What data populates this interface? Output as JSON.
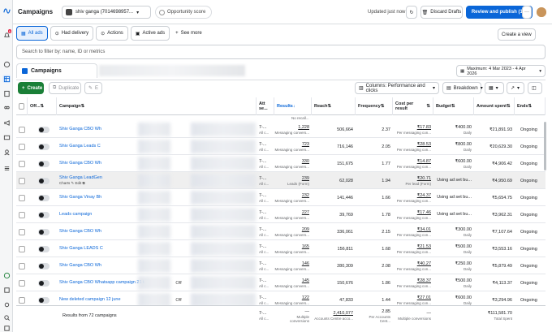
{
  "header": {
    "title": "Campaigns",
    "account": "shiv ganga (7014698957...",
    "opportunity": "Opportunity score",
    "updated": "Updated just now",
    "discard": "Discard Drafts",
    "publish": "Review and publish (10)",
    "more": "···"
  },
  "nav": {
    "badge": "6"
  },
  "tabs": {
    "all_ads": "All ads",
    "had_delivery": "Had delivery",
    "actions": "Actions",
    "active_ads": "Active ads",
    "see_more": "See more",
    "create_view": "Create a view"
  },
  "filter": {
    "placeholder": "Search to filter by: name, ID or metrics"
  },
  "level_tab": "Campaigns",
  "date_range": "Maximum: 4 Mar 2023 - 4 Apr 2026",
  "toolbar": {
    "create": "Create",
    "duplicate": "Duplicate",
    "edit": "E",
    "columns": "Columns: Performance and clicks",
    "breakdown": "Breakdown"
  },
  "columns": [
    "Off...",
    "Campaign",
    "Att se...",
    "Results",
    "Reach",
    "Frequency",
    "Cost per result",
    "Budget",
    "Amount spent",
    "Ends"
  ],
  "top_partial_row": {
    "results_sub": "No recall..."
  },
  "rows": [
    {
      "toggle": "",
      "name": "Shiv Ganga CBO Wh",
      "attr": "7-...",
      "attr_sub": "All c...",
      "results": "1,228",
      "results_sub": "Messaging convers...",
      "reach": "506,664",
      "freq": "2.37",
      "cpr": "₹17.83",
      "cpr_sub": "Per messaging con...",
      "budget": "₹400.00",
      "budget_sub": "Daily",
      "spent": "₹21,891.93",
      "ends": "Ongoing",
      "highlight": false,
      "actions": ""
    },
    {
      "toggle": "",
      "name": "Shiv Ganga Leads C",
      "attr": "7-...",
      "attr_sub": "All c...",
      "results": "723",
      "results_sub": "Messaging convers...",
      "reach": "716,146",
      "freq": "2.05",
      "cpr": "₹28.53",
      "cpr_sub": "Per messaging con...",
      "budget": "₹800.00",
      "budget_sub": "Daily",
      "spent": "₹20,629.30",
      "ends": "Ongoing",
      "highlight": false,
      "actions": ""
    },
    {
      "toggle": "",
      "name": "Shiv Ganga CBO Wh",
      "attr": "7-...",
      "attr_sub": "All c...",
      "results": "330",
      "results_sub": "Messaging convers...",
      "reach": "151,675",
      "freq": "1.77",
      "cpr": "₹14.87",
      "cpr_sub": "Per messaging con...",
      "budget": "₹600.00",
      "budget_sub": "Daily",
      "spent": "₹4,906.42",
      "ends": "Ongoing",
      "highlight": false,
      "actions": ""
    },
    {
      "toggle": "",
      "name": "Shiv Ganga LeadGen",
      "attr": "7-...",
      "attr_sub": "All c...",
      "results": "239",
      "results_sub": "Leads (Form)",
      "reach": "62,028",
      "freq": "1.94",
      "cpr": "₹20.71",
      "cpr_sub": "Per lead (Form)",
      "budget": "Using ad set bu...",
      "budget_sub": "",
      "spent": "₹4,950.69",
      "ends": "Ongoing",
      "highlight": true,
      "actions": "Charts  ✎ Edit  ⧉"
    },
    {
      "toggle": "",
      "name": "Shiv Ganga Vinay Bh",
      "attr": "7-...",
      "attr_sub": "All c...",
      "results": "232",
      "results_sub": "Messaging convers...",
      "reach": "141,446",
      "freq": "1.66",
      "cpr": "₹24.37",
      "cpr_sub": "Per messaging con...",
      "budget": "Using ad set bu...",
      "budget_sub": "",
      "spent": "₹5,654.75",
      "ends": "Ongoing",
      "highlight": false,
      "actions": ""
    },
    {
      "toggle": "",
      "name": "Leads campaign",
      "attr": "7-...",
      "attr_sub": "All c...",
      "results": "227",
      "results_sub": "Messaging convers...",
      "reach": "39,769",
      "freq": "1.78",
      "cpr": "₹17.46",
      "cpr_sub": "Per messaging con...",
      "budget": "Using ad set bu...",
      "budget_sub": "",
      "spent": "₹3,962.31",
      "ends": "Ongoing",
      "highlight": false,
      "actions": ""
    },
    {
      "toggle": "",
      "name": "Shiv Ganga CBO Wh",
      "attr": "7-...",
      "attr_sub": "All c...",
      "results": "209",
      "results_sub": "Messaging convers...",
      "reach": "336,061",
      "freq": "2.15",
      "cpr": "₹34.01",
      "cpr_sub": "Per messaging con...",
      "budget": "₹300.00",
      "budget_sub": "Daily",
      "spent": "₹7,107.64",
      "ends": "Ongoing",
      "highlight": false,
      "actions": ""
    },
    {
      "toggle": "",
      "name": "Shiv Ganga LEADS C",
      "attr": "7-...",
      "attr_sub": "All c...",
      "results": "165",
      "results_sub": "Messaging convers...",
      "reach": "156,811",
      "freq": "1.68",
      "cpr": "₹21.53",
      "cpr_sub": "Per messaging con...",
      "budget": "₹500.00",
      "budget_sub": "Daily",
      "spent": "₹3,553.16",
      "ends": "Ongoing",
      "highlight": false,
      "actions": ""
    },
    {
      "toggle": "",
      "name": "Shiv Ganga CBO Wh",
      "attr": "7-...",
      "attr_sub": "All c...",
      "results": "146",
      "results_sub": "Messaging convers...",
      "reach": "280,309",
      "freq": "2.08",
      "cpr": "₹40.27",
      "cpr_sub": "Per messaging con...",
      "budget": "₹250.00",
      "budget_sub": "Daily",
      "spent": "₹5,879.49",
      "ends": "Ongoing",
      "highlight": false,
      "actions": ""
    },
    {
      "toggle": "Off",
      "name": "Shiv Ganga CBO Whatsapp campaign 21 tab...",
      "attr": "7-...",
      "attr_sub": "All c...",
      "results": "145",
      "results_sub": "Messaging convers...",
      "reach": "150,676",
      "freq": "1.86",
      "cpr": "₹28.37",
      "cpr_sub": "Per messaging con...",
      "budget": "₹500.00",
      "budget_sub": "Daily",
      "spent": "₹4,113.37",
      "ends": "Ongoing",
      "highlight": false,
      "actions": ""
    },
    {
      "toggle": "Off",
      "name": "New deleted campaign 12 june",
      "attr": "7-...",
      "attr_sub": "All c...",
      "results": "122",
      "results_sub": "Messaging convers...",
      "reach": "47,833",
      "freq": "1.44",
      "cpr": "₹27.01",
      "cpr_sub": "Per messaging con...",
      "budget": "₹600.00",
      "budget_sub": "Daily",
      "spent": "₹3,294.96",
      "ends": "Ongoing",
      "highlight": false,
      "actions": ""
    }
  ],
  "footer": {
    "label": "Results from 72 campaigns",
    "attr": "7-...",
    "attr_sub": "All c...",
    "results": "—",
    "results_sub": "Multiple conversions",
    "reach": "2,410,077",
    "reach_sub": "Accounts Centre acco...",
    "freq": "2.85",
    "freq_sub": "Per Accounts Cent...",
    "cpr": "—",
    "cpr_sub": "Multiple conversions",
    "spent": "₹111,581.70",
    "spent_sub": "Total Spent"
  }
}
